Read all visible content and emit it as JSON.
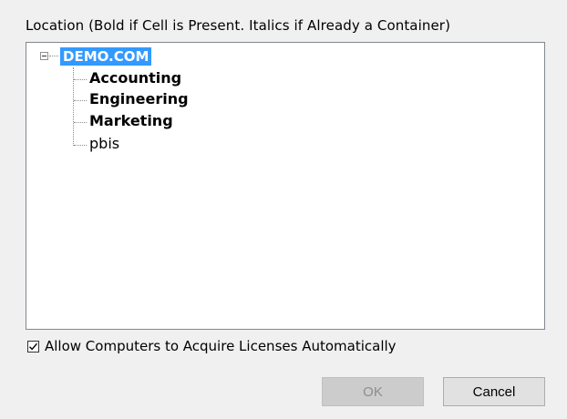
{
  "location_label": "Location (Bold if Cell is Present. Italics if Already a Container)",
  "tree": {
    "root": {
      "label": "DEMO.COM",
      "expanded": true,
      "selected": true,
      "children": [
        {
          "label": "Accounting",
          "bold": true
        },
        {
          "label": "Engineering",
          "bold": true
        },
        {
          "label": "Marketing",
          "bold": true
        },
        {
          "label": "pbis",
          "bold": false
        }
      ]
    }
  },
  "checkbox": {
    "label": "Allow Computers to Acquire Licenses Automatically",
    "checked": true
  },
  "buttons": {
    "ok_label": "OK",
    "ok_enabled": false,
    "cancel_label": "Cancel"
  },
  "colors": {
    "selection_bg": "#3399ff",
    "panel_border": "#828790",
    "dialog_bg": "#f0f0f0"
  }
}
